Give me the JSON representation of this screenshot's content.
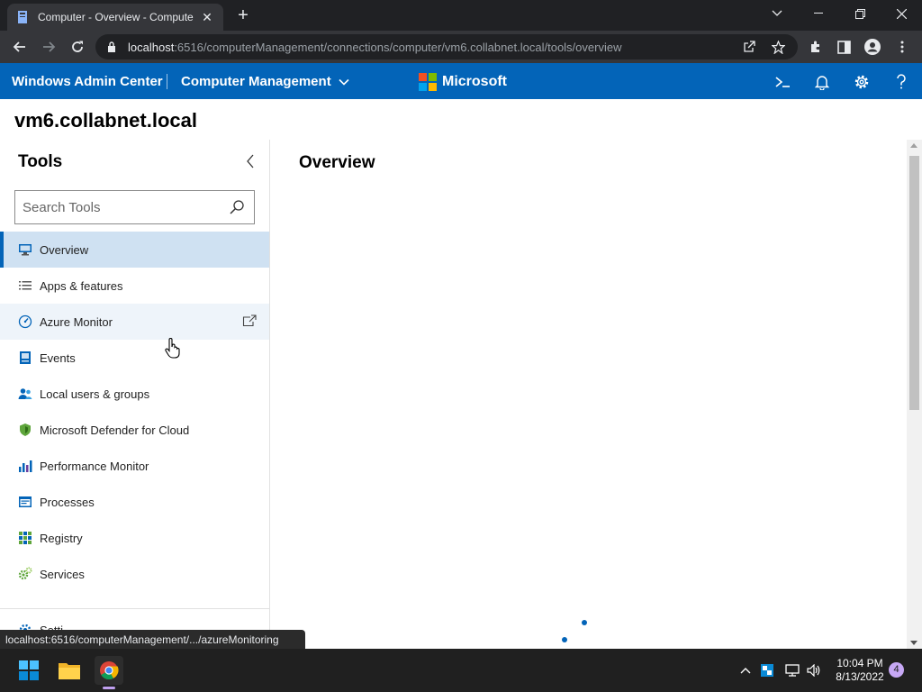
{
  "browser": {
    "tab_title": "Computer - Overview - Compute",
    "url_host": "localhost",
    "url_path": ":6516/computerManagement/connections/computer/vm6.collabnet.local/tools/overview",
    "status_url": "localhost:6516/computerManagement/.../azureMonitoring"
  },
  "header": {
    "brand": "Windows Admin Center",
    "solution": "Computer Management",
    "microsoft": "Microsoft",
    "colors": {
      "header_bg": "#0364b8",
      "ms_red": "#f25022",
      "ms_green": "#7fba00",
      "ms_blue": "#00a4ef",
      "ms_yellow": "#ffb900"
    }
  },
  "server": {
    "name": "vm6.collabnet.local"
  },
  "tools": {
    "title": "Tools",
    "search_placeholder": "Search Tools",
    "items": [
      {
        "label": "Overview",
        "icon": "monitor-icon",
        "state": "selected"
      },
      {
        "label": "Apps & features",
        "icon": "list-icon",
        "state": ""
      },
      {
        "label": "Azure Monitor",
        "icon": "gauge-icon",
        "state": "hover",
        "external": true
      },
      {
        "label": "Events",
        "icon": "events-icon",
        "state": ""
      },
      {
        "label": "Local users & groups",
        "icon": "users-icon",
        "state": ""
      },
      {
        "label": "Microsoft Defender for Cloud",
        "icon": "shield-icon",
        "state": ""
      },
      {
        "label": "Performance Monitor",
        "icon": "chart-icon",
        "state": ""
      },
      {
        "label": "Processes",
        "icon": "processes-icon",
        "state": ""
      },
      {
        "label": "Registry",
        "icon": "registry-icon",
        "state": ""
      },
      {
        "label": "Services",
        "icon": "gears-icon",
        "state": ""
      }
    ],
    "settings_label": "Setti"
  },
  "main": {
    "title": "Overview"
  },
  "taskbar": {
    "time": "10:04 PM",
    "date": "8/13/2022",
    "notifications": "4"
  }
}
